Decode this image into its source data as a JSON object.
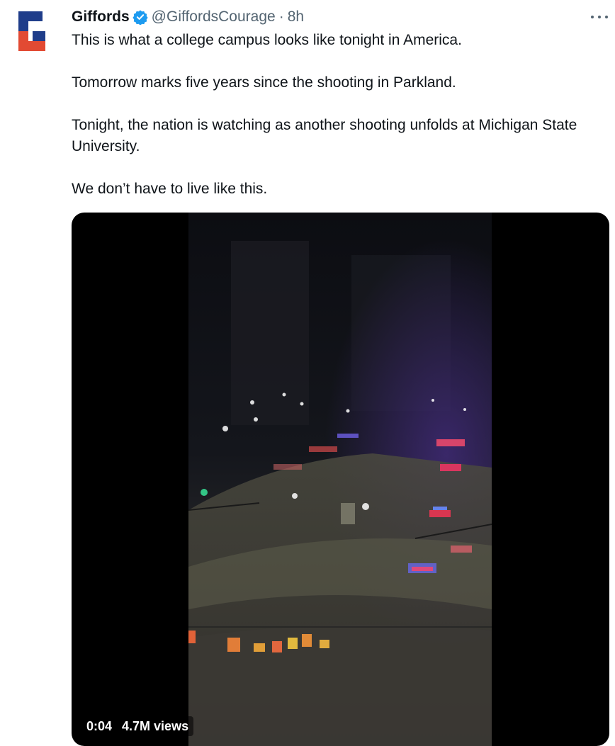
{
  "tweet": {
    "author_name": "Giffords",
    "author_handle": "@GiffordsCourage",
    "separator": "·",
    "timestamp": "8h",
    "paragraphs": [
      "This is what a college campus looks like tonight in America.",
      "Tomorrow marks five years since the shooting in Parkland.",
      "Tonight, the nation is watching as another shooting unfolds at Michigan State University.",
      "We don’t have to live like this."
    ]
  },
  "video": {
    "duration": "0:04",
    "views": "4.7M views"
  },
  "icons": {
    "avatar": "giffords-g-logo",
    "verified": "verified-badge-icon",
    "more": "more-options-icon"
  },
  "colors": {
    "text_primary": "#0f1419",
    "text_secondary": "#536471",
    "verified_blue": "#1d9bf0",
    "logo_blue": "#1f3d8a",
    "logo_red": "#e24a33"
  }
}
